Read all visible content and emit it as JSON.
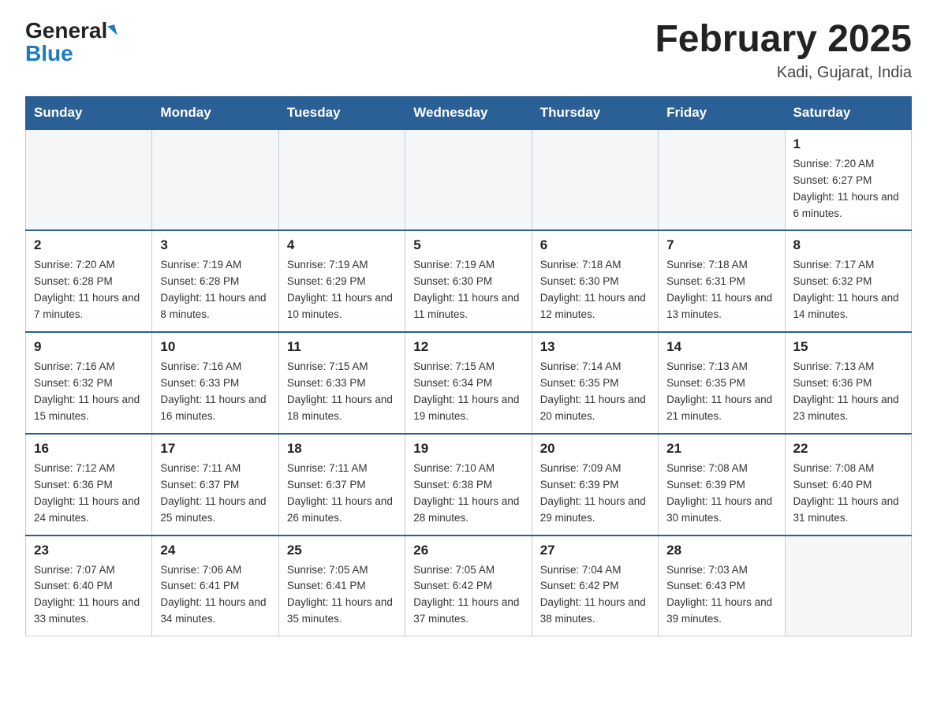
{
  "header": {
    "logo_general": "General",
    "logo_blue": "Blue",
    "title": "February 2025",
    "location": "Kadi, Gujarat, India"
  },
  "days_of_week": [
    "Sunday",
    "Monday",
    "Tuesday",
    "Wednesday",
    "Thursday",
    "Friday",
    "Saturday"
  ],
  "weeks": [
    [
      {
        "day": "",
        "info": ""
      },
      {
        "day": "",
        "info": ""
      },
      {
        "day": "",
        "info": ""
      },
      {
        "day": "",
        "info": ""
      },
      {
        "day": "",
        "info": ""
      },
      {
        "day": "",
        "info": ""
      },
      {
        "day": "1",
        "info": "Sunrise: 7:20 AM\nSunset: 6:27 PM\nDaylight: 11 hours and 6 minutes."
      }
    ],
    [
      {
        "day": "2",
        "info": "Sunrise: 7:20 AM\nSunset: 6:28 PM\nDaylight: 11 hours and 7 minutes."
      },
      {
        "day": "3",
        "info": "Sunrise: 7:19 AM\nSunset: 6:28 PM\nDaylight: 11 hours and 8 minutes."
      },
      {
        "day": "4",
        "info": "Sunrise: 7:19 AM\nSunset: 6:29 PM\nDaylight: 11 hours and 10 minutes."
      },
      {
        "day": "5",
        "info": "Sunrise: 7:19 AM\nSunset: 6:30 PM\nDaylight: 11 hours and 11 minutes."
      },
      {
        "day": "6",
        "info": "Sunrise: 7:18 AM\nSunset: 6:30 PM\nDaylight: 11 hours and 12 minutes."
      },
      {
        "day": "7",
        "info": "Sunrise: 7:18 AM\nSunset: 6:31 PM\nDaylight: 11 hours and 13 minutes."
      },
      {
        "day": "8",
        "info": "Sunrise: 7:17 AM\nSunset: 6:32 PM\nDaylight: 11 hours and 14 minutes."
      }
    ],
    [
      {
        "day": "9",
        "info": "Sunrise: 7:16 AM\nSunset: 6:32 PM\nDaylight: 11 hours and 15 minutes."
      },
      {
        "day": "10",
        "info": "Sunrise: 7:16 AM\nSunset: 6:33 PM\nDaylight: 11 hours and 16 minutes."
      },
      {
        "day": "11",
        "info": "Sunrise: 7:15 AM\nSunset: 6:33 PM\nDaylight: 11 hours and 18 minutes."
      },
      {
        "day": "12",
        "info": "Sunrise: 7:15 AM\nSunset: 6:34 PM\nDaylight: 11 hours and 19 minutes."
      },
      {
        "day": "13",
        "info": "Sunrise: 7:14 AM\nSunset: 6:35 PM\nDaylight: 11 hours and 20 minutes."
      },
      {
        "day": "14",
        "info": "Sunrise: 7:13 AM\nSunset: 6:35 PM\nDaylight: 11 hours and 21 minutes."
      },
      {
        "day": "15",
        "info": "Sunrise: 7:13 AM\nSunset: 6:36 PM\nDaylight: 11 hours and 23 minutes."
      }
    ],
    [
      {
        "day": "16",
        "info": "Sunrise: 7:12 AM\nSunset: 6:36 PM\nDaylight: 11 hours and 24 minutes."
      },
      {
        "day": "17",
        "info": "Sunrise: 7:11 AM\nSunset: 6:37 PM\nDaylight: 11 hours and 25 minutes."
      },
      {
        "day": "18",
        "info": "Sunrise: 7:11 AM\nSunset: 6:37 PM\nDaylight: 11 hours and 26 minutes."
      },
      {
        "day": "19",
        "info": "Sunrise: 7:10 AM\nSunset: 6:38 PM\nDaylight: 11 hours and 28 minutes."
      },
      {
        "day": "20",
        "info": "Sunrise: 7:09 AM\nSunset: 6:39 PM\nDaylight: 11 hours and 29 minutes."
      },
      {
        "day": "21",
        "info": "Sunrise: 7:08 AM\nSunset: 6:39 PM\nDaylight: 11 hours and 30 minutes."
      },
      {
        "day": "22",
        "info": "Sunrise: 7:08 AM\nSunset: 6:40 PM\nDaylight: 11 hours and 31 minutes."
      }
    ],
    [
      {
        "day": "23",
        "info": "Sunrise: 7:07 AM\nSunset: 6:40 PM\nDaylight: 11 hours and 33 minutes."
      },
      {
        "day": "24",
        "info": "Sunrise: 7:06 AM\nSunset: 6:41 PM\nDaylight: 11 hours and 34 minutes."
      },
      {
        "day": "25",
        "info": "Sunrise: 7:05 AM\nSunset: 6:41 PM\nDaylight: 11 hours and 35 minutes."
      },
      {
        "day": "26",
        "info": "Sunrise: 7:05 AM\nSunset: 6:42 PM\nDaylight: 11 hours and 37 minutes."
      },
      {
        "day": "27",
        "info": "Sunrise: 7:04 AM\nSunset: 6:42 PM\nDaylight: 11 hours and 38 minutes."
      },
      {
        "day": "28",
        "info": "Sunrise: 7:03 AM\nSunset: 6:43 PM\nDaylight: 11 hours and 39 minutes."
      },
      {
        "day": "",
        "info": ""
      }
    ]
  ]
}
